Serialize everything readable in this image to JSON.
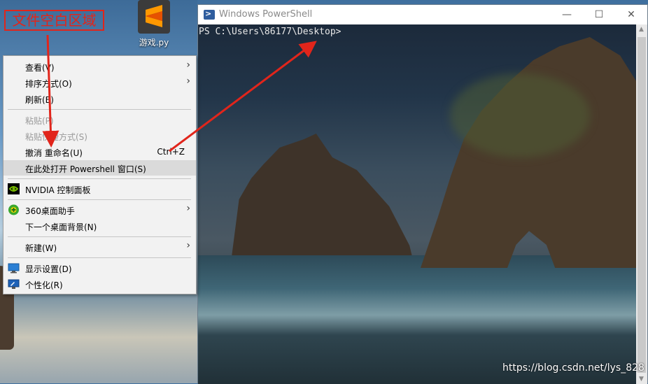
{
  "annotation": {
    "text": "文件空白区域",
    "color": "#e1251b"
  },
  "desktop_icon": {
    "label": "游戏.py",
    "icon": "sublime-text-icon"
  },
  "powershell": {
    "title": "Windows PowerShell",
    "prompt": "PS C:\\Users\\86177\\Desktop>",
    "buttons": {
      "minimize": "—",
      "maximize": "☐",
      "close": "✕"
    }
  },
  "context_menu": {
    "items": [
      {
        "label": "查看(V)",
        "submenu": true
      },
      {
        "label": "排序方式(O)",
        "submenu": true
      },
      {
        "label": "刷新(E)"
      },
      {
        "label": "粘贴(P)",
        "disabled": true
      },
      {
        "label": "粘贴快捷方式(S)",
        "disabled": true
      },
      {
        "label": "撤消 重命名(U)",
        "shortcut": "Ctrl+Z"
      },
      {
        "label": "在此处打开 Powershell 窗口(S)",
        "highlighted": true
      },
      {
        "label": "NVIDIA 控制面板",
        "icon": "nvidia-icon"
      },
      {
        "label": "360桌面助手",
        "icon": "360-icon",
        "submenu": true
      },
      {
        "label": "下一个桌面背景(N)"
      },
      {
        "label": "新建(W)",
        "submenu": true
      },
      {
        "label": "显示设置(D)",
        "icon": "display-icon"
      },
      {
        "label": "个性化(R)",
        "icon": "personalize-icon"
      }
    ],
    "arrow_glyph": "›"
  },
  "watermark": "https://blog.csdn.net/lys_828"
}
